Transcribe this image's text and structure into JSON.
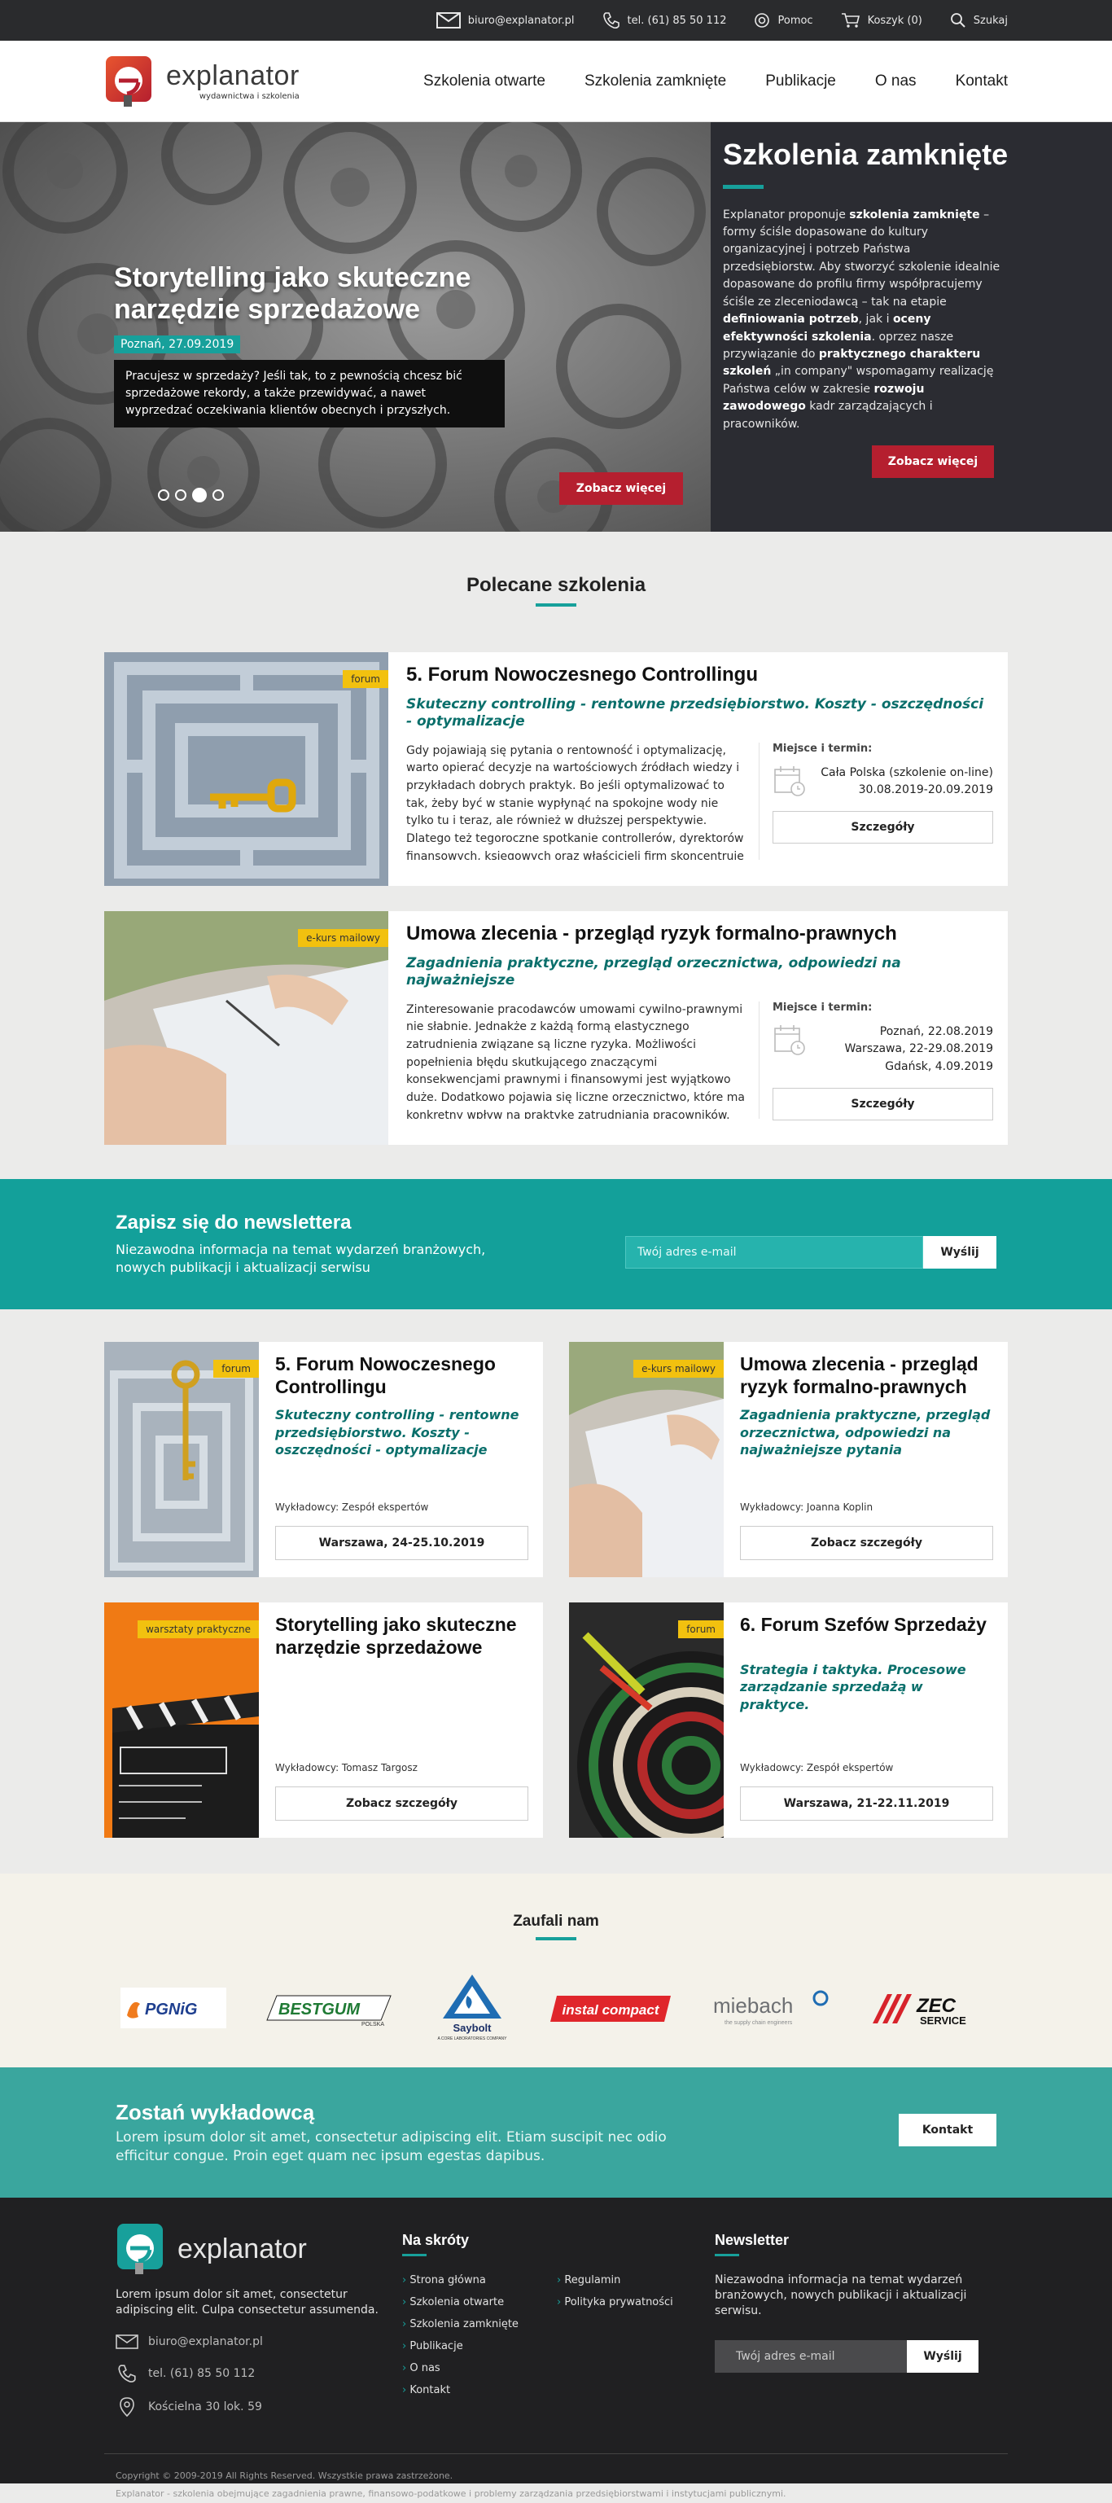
{
  "topbar": {
    "email": "biuro@explanator.pl",
    "phone": "tel. (61) 85 50 112",
    "help": "Pomoc",
    "cart": "Koszyk (0)",
    "search": "Szukaj"
  },
  "brand": {
    "name": "explanator",
    "tagline": "wydawnictwa i szkolenia",
    "accent": "#17a09b",
    "red": "#b51f2f"
  },
  "nav": [
    "Szkolenia otwarte",
    "Szkolenia zamknięte",
    "Publikacje",
    "O nas",
    "Kontakt"
  ],
  "hero": {
    "title": "Storytelling jako skuteczne narzędzie sprzedażowe",
    "date": "Poznań, 27.09.2019",
    "description": "Pracujesz w sprzedaży? Jeśli tak, to z pewnością chcesz bić sprzedażowe rekordy, a także przewidywać, a nawet wyprzedzać oczekiwania klientów obecnych i przyszłych.",
    "button": "Zobacz więcej",
    "slides": 4,
    "active_slide": 3
  },
  "closed": {
    "title": "Szkolenia zamknięte",
    "p1": "Explanator proponuje ",
    "b1": "szkolenia zamknięte",
    "p2": " – formy ściśle dopasowane do kultury organizacyjnej i potrzeb Państwa przedsiębiorstw. Aby stworzyć szkolenie idealnie dopasowane do profilu firmy współpracujemy ściśle ze zleceniodawcą – tak na etapie ",
    "b2": "definiowania potrzeb",
    "p3": ", jak i ",
    "b3": "oceny efektywności szkolenia",
    "p4": ". oprzez nasze przywiązanie do ",
    "b4": "praktycznego charakteru szkoleń",
    "p5": " „in company\" wspomagamy realizację Państwa celów w zakresie ",
    "b5": "rozwoju zawodowego",
    "p6": " kadr zarządzających i pracowników.",
    "button": "Zobacz więcej"
  },
  "featured": {
    "heading": "Polecane szkolenia",
    "items": [
      {
        "tag": "forum",
        "title": "5. Forum Nowoczesnego Controllingu",
        "subtitle": "Skuteczny controlling - rentowne przedsiębiorstwo. Koszty - oszczędności - optymalizacje",
        "description": "Gdy pojawiają się pytania o rentowność i optymalizację, warto opierać decyzje na wartościowych źródłach wiedzy i przykładach dobrych praktyk. Bo jeśli optymalizować to tak, żeby być w stanie wypłynąć na spokojne wody nie tylko tu i teraz, ale również w dłuższej perspektywie. Dlatego też tegoroczne spotkanie controllerów, dyrektorów finansowych, księgowych oraz właścicieli firm skoncentruje",
        "place_label": "Miejsce i termin:",
        "dates": [
          "Cała Polska (szkolenie on-line)",
          "30.08.2019-20.09.2019"
        ],
        "button": "Szczegóły"
      },
      {
        "tag": "e-kurs mailowy",
        "title": "Umowa zlecenia - przegląd ryzyk formalno-prawnych",
        "subtitle": "Zagadnienia praktyczne, przegląd orzecznictwa, odpowiedzi na najważniejsze",
        "description": "Zinteresowanie pracodawców umowami cywilno-prawnymi nie słabnie. Jednakże z każdą formą elastycznego zatrudnienia związane są liczne ryzyka. Możliwości popełnienia błędu skutkującego znaczącymi konsekwencjami prawnymi i finansowymi jest wyjątkowo duże. Dodatkowo pojawia się liczne orzecznictwo, które ma konkretny wpływ na praktykę zatrudniania pracowników.",
        "place_label": "Miejsce i termin:",
        "dates": [
          "Poznań, 22.08.2019",
          "Warszawa, 22-29.08.2019",
          "Gdańsk, 4.09.2019"
        ],
        "button": "Szczegóły"
      }
    ]
  },
  "newsletter": {
    "title": "Zapisz się do newslettera",
    "description": "Niezawodna informacja na temat wydarzeń branżowych, nowych publikacji i aktualizacji serwisu",
    "placeholder": "Twój adres e-mail",
    "button": "Wyślij"
  },
  "grid": [
    {
      "tag": "forum",
      "title": "5. Forum Nowoczesnego Controllingu",
      "subtitle": "Skuteczny controlling - rentowne przedsiębiorstwo. Koszty - oszczędności - optymalizacje",
      "lecturers": "Wykładowcy: Zespół ekspertów",
      "button": "Warszawa, 24-25.10.2019"
    },
    {
      "tag": "e-kurs mailowy",
      "title": "Umowa zlecenia - przegląd ryzyk formalno-prawnych",
      "subtitle": "Zagadnienia praktyczne, przegląd orzecznictwa, odpowiedzi na najważniejsze pytania",
      "lecturers": "Wykładowcy: Joanna Koplin",
      "button": "Zobacz szczegóły"
    },
    {
      "tag": "warsztaty praktyczne",
      "title": "Storytelling jako skuteczne narzędzie sprzedażowe",
      "subtitle": "",
      "lecturers": "Wykładowcy: Tomasz Targosz",
      "button": "Zobacz szczegóły"
    },
    {
      "tag": "forum",
      "title": "6. Forum Szefów Sprzedaży",
      "subtitle": "Strategia i taktyka. Procesowe zarządzanie sprzedażą w praktyce.",
      "lecturers": "Wykładowcy: Zespół ekspertów",
      "button": "Warszawa, 21-22.11.2019"
    }
  ],
  "trust": {
    "heading": "Zaufali nam",
    "logos": [
      "PGNiG",
      "BESTGUM",
      "POLSKA",
      "Saybolt",
      "A CORE LABORATORIES COMPANY",
      "instal compact",
      "miebach",
      "the supply chain engineers",
      "ZEC",
      "SERVICE"
    ]
  },
  "become": {
    "title": "Zostań wykładowcą",
    "description": "Lorem ipsum dolor sit amet, consectetur adipiscing elit. Etiam suscipit nec odio efficitur congue. Proin eget quam nec ipsum egestas dapibus.",
    "button": "Kontakt"
  },
  "footer": {
    "about": "Lorem ipsum dolor sit amet, consectetur adipiscing elit. Culpa consectetur assumenda.",
    "email": "biuro@explanator.pl",
    "phone": "tel. (61) 85 50 112",
    "address": "Kościelna 30 lok. 59",
    "links_heading": "Na skróty",
    "links": [
      "Strona główna",
      "Regulamin",
      "Szkolenia otwarte",
      "Polityka prywatności",
      "Szkolenia zamknięte",
      "",
      "Publikacje",
      "",
      "O nas",
      "",
      "Kontakt",
      ""
    ],
    "nl_heading": "Newsletter",
    "nl_text": "Niezawodna informacja na temat wydarzeń branżowych, nowych publikacji i aktualizacji serwisu.",
    "nl_placeholder": "Twój adres e-mail",
    "nl_button": "Wyślij",
    "copyright": "Copyright © 2009-2019 All Rights Reserved. Wszystkie prawa zastrzeżone.",
    "tagline": "Explanator - szkolenia obejmujące zagadnienia prawne, finansowo-podatkowe i problemy zarządzania przedsiębiorstwami i instytucjami publicznymi."
  }
}
